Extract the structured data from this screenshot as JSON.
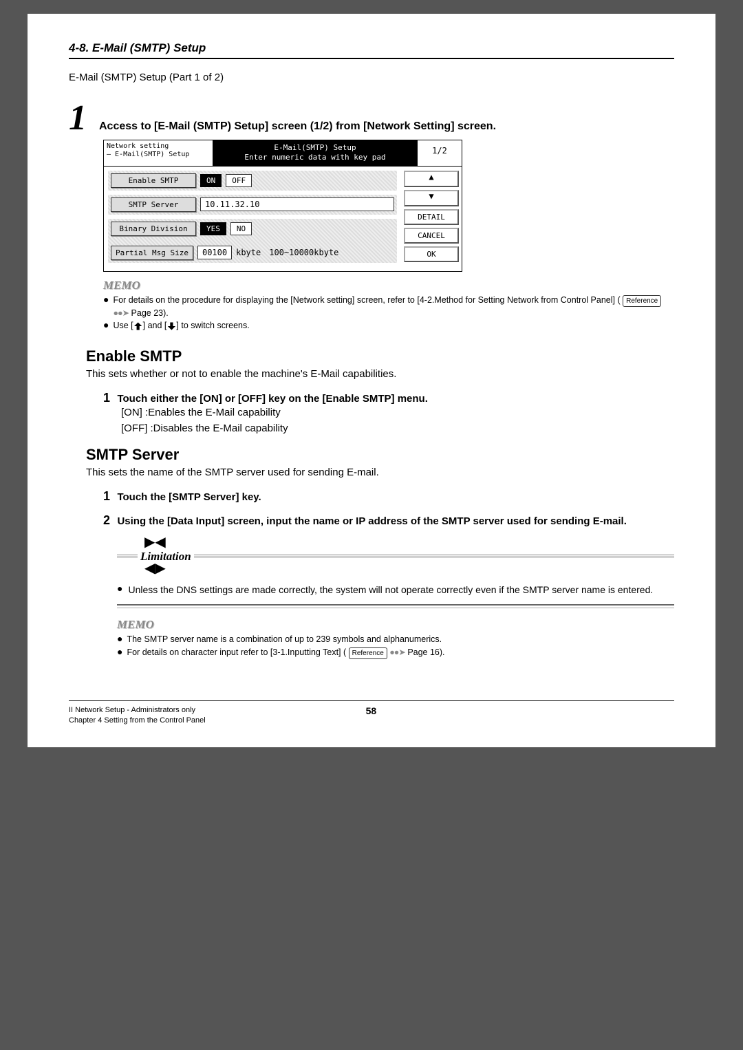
{
  "header": {
    "title": "4-8. E-Mail (SMTP) Setup"
  },
  "intro": "E-Mail (SMTP) Setup (Part 1 of 2)",
  "step1": {
    "num": "1",
    "text": "Access to [E-Mail (SMTP) Setup] screen (1/2) from [Network Setting] screen."
  },
  "screenshot": {
    "breadcrumb_top": "Network setting",
    "breadcrumb_sub": "— E-Mail(SMTP) Setup",
    "title_line1": "E-Mail(SMTP) Setup",
    "title_line2": "Enter numeric data with key pad",
    "page": "1/2",
    "enable_label": "Enable SMTP",
    "enable_on": "ON",
    "enable_off": "OFF",
    "server_label": "SMTP Server",
    "server_value": "10.11.32.10",
    "binary_label": "Binary Division",
    "binary_yes": "YES",
    "binary_no": "NO",
    "partial_label": "Partial Msg Size",
    "partial_value": "00100",
    "partial_unit": "kbyte",
    "partial_range": "100~10000kbyte",
    "btn_detail": "DETAIL",
    "btn_cancel": "CANCEL",
    "btn_ok": "OK"
  },
  "memo1": {
    "title": "MEMO",
    "item1_a": "For details on the procedure for displaying the [Network setting] screen, refer to [4-2.Method for Setting Network from Control Panel] (",
    "item1_ref": "Reference",
    "item1_b": " Page 23).",
    "item2_a": "Use [",
    "item2_b": "] and [",
    "item2_c": "] to switch screens."
  },
  "enable_section": {
    "heading": "Enable SMTP",
    "desc": "This sets whether or not to enable the machine's E-Mail capabilities.",
    "sub1_title": "Touch either the [ON] or [OFF] key on the [Enable SMTP] menu.",
    "sub1_on": "[ON]   :Enables the E-Mail capability",
    "sub1_off": "[OFF] :Disables the E-Mail capability"
  },
  "server_section": {
    "heading": "SMTP Server",
    "desc": "This sets the name of the SMTP server used for sending E-mail.",
    "sub1_title": "Touch the [SMTP Server] key.",
    "sub2_title": "Using the [Data Input] screen, input the name or IP address of the SMTP server used for sending E-mail."
  },
  "limitation": {
    "label": "Limitation",
    "item": "Unless the DNS settings are made correctly, the system will not operate correctly even if the SMTP server name is entered."
  },
  "memo2": {
    "title": "MEMO",
    "item1": "The SMTP server name is a combination of up to 239 symbols and alphanumerics.",
    "item2_a": "For details on character input refer to [3-1.Inputting Text] ( ",
    "item2_ref": "Reference",
    "item2_b": " Page 16)."
  },
  "footer": {
    "left1": "II Network Setup - Administrators only",
    "left2": "Chapter 4 Setting from the Control Panel",
    "page": "58"
  }
}
